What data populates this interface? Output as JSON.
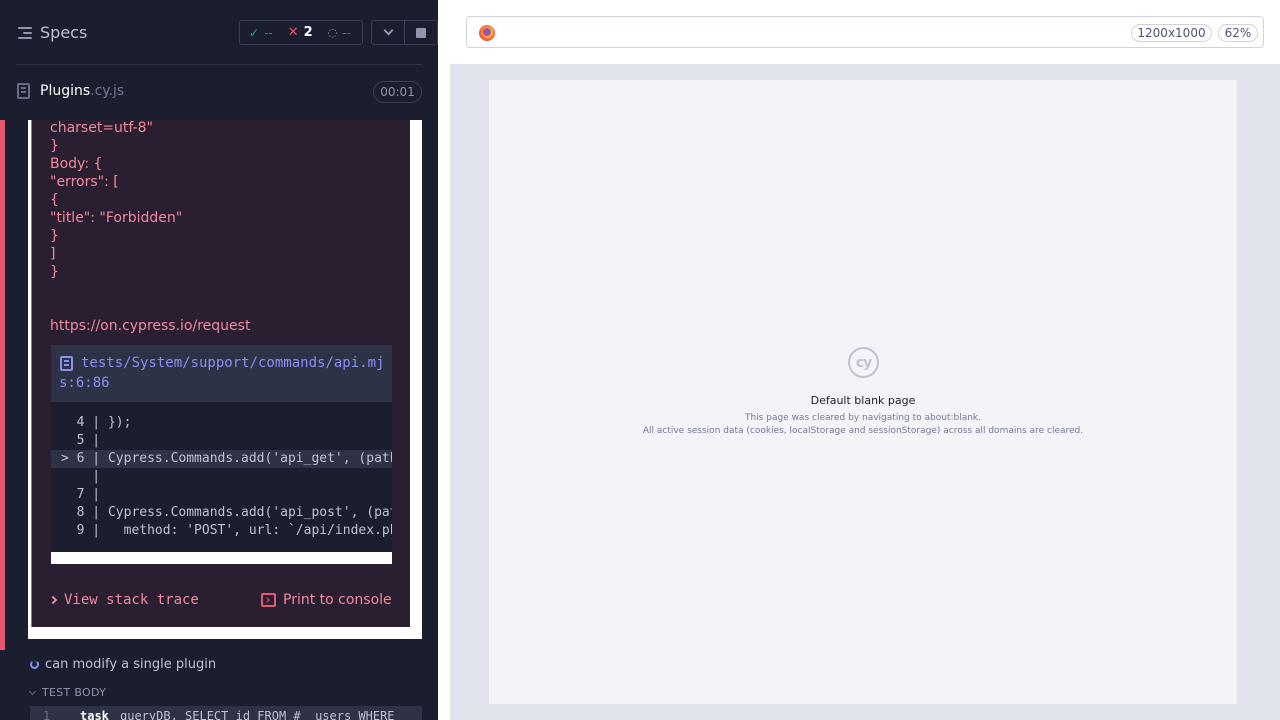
{
  "header": {
    "title": "Specs",
    "passed_icon": "check-icon",
    "passed_count": "--",
    "failed_icon": "x-icon",
    "failed_count": "2",
    "pending_icon": "spinner-icon",
    "pending_count": "--"
  },
  "spec": {
    "name": "Plugins",
    "extension": ".cy.js",
    "duration": "00:01"
  },
  "error": {
    "lines": [
      "charset=utf-8\"",
      "}",
      "Body: {",
      "\"errors\": [",
      "{",
      "\"title\": \"Forbidden\"",
      "}",
      "]",
      "}"
    ],
    "docs_link": "https://on.cypress.io/request",
    "code_frame": {
      "file_path": "tests/System/support/commands/api.mjs:6:86",
      "lines": [
        "  4 | });",
        "  5 |",
        "> 6 | Cypress.Commands.add('api_get', (path",
        "    |",
        "  7 |",
        "  8 | Cypress.Commands.add('api_post', (pat",
        "  9 |   method: 'POST', url: `/api/index.ph"
      ],
      "highlight_index": 2
    },
    "view_stack_trace_label": "View stack trace",
    "print_to_console_label": "Print to console"
  },
  "next_test": {
    "title": "can modify a single plugin",
    "section_label": "TEST BODY",
    "command": {
      "number": "1",
      "name": "task",
      "message": "queryDB, SELECT id FROM #__users WHERE"
    }
  },
  "aut": {
    "viewport_size": "1200x1000",
    "zoom": "62%",
    "browser_icon": "firefox-icon",
    "logo_text": "cy",
    "blank_title": "Default blank page",
    "blank_line1": "This page was cleared by navigating to about:blank.",
    "blank_line2": "All active session data (cookies, localStorage and sessionStorage) across all domains are cleared."
  },
  "colors": {
    "reporter_bg": "#1b1e2e",
    "fail": "#e45770",
    "pass": "#1fa971",
    "accent": "#8890f0"
  }
}
